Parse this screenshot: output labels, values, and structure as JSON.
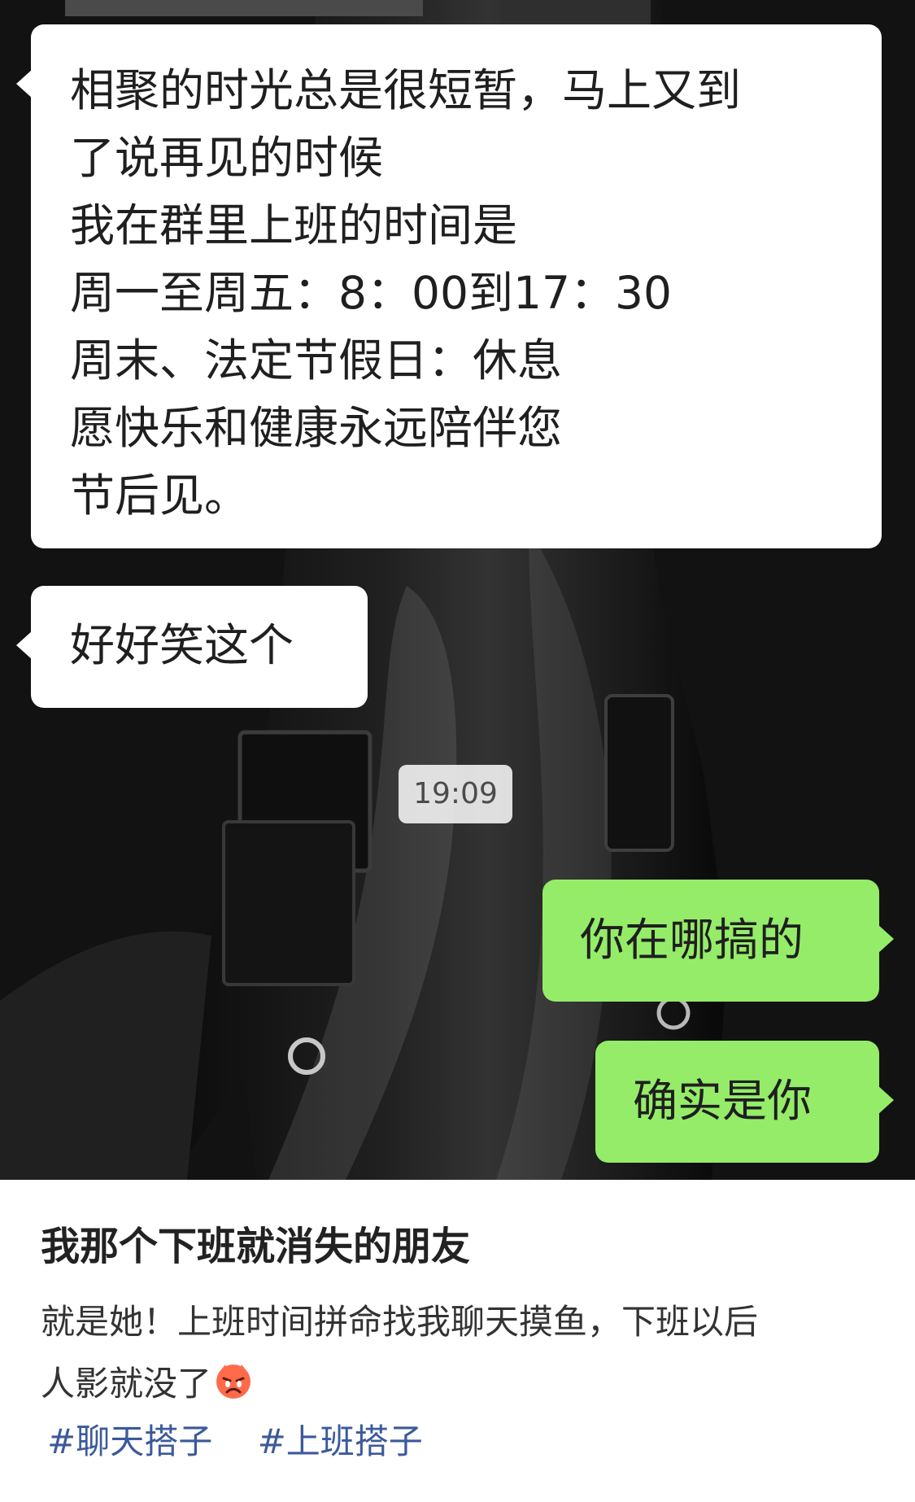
{
  "chat": {
    "incoming_messages": [
      {
        "lines": [
          "相聚的时光总是很短暂，马上又到",
          "了说再见的时候",
          "我在群里上班的时间是",
          "周一至周五：8：00到17：30",
          "周末、法定节假日：休息",
          "愿快乐和健康永远陪伴您",
          "节后见。"
        ]
      },
      {
        "text": "好好笑这个"
      }
    ],
    "timestamp": "19:09",
    "outgoing_messages": [
      "你在哪搞的",
      "确实是你"
    ]
  },
  "post": {
    "title": "我那个下班就消失的朋友",
    "body_lines": [
      "就是她！上班时间拼命找我聊天摸鱼，下班以后",
      "人影就没了"
    ],
    "emoji": "angry-face-emoji",
    "tags": [
      "#聊天搭子",
      "#上班搭子"
    ]
  },
  "colors": {
    "incoming_bubble": "#ffffff",
    "outgoing_bubble": "#95ec69",
    "tag_link": "#3c5a9a",
    "title_text": "#222222"
  }
}
